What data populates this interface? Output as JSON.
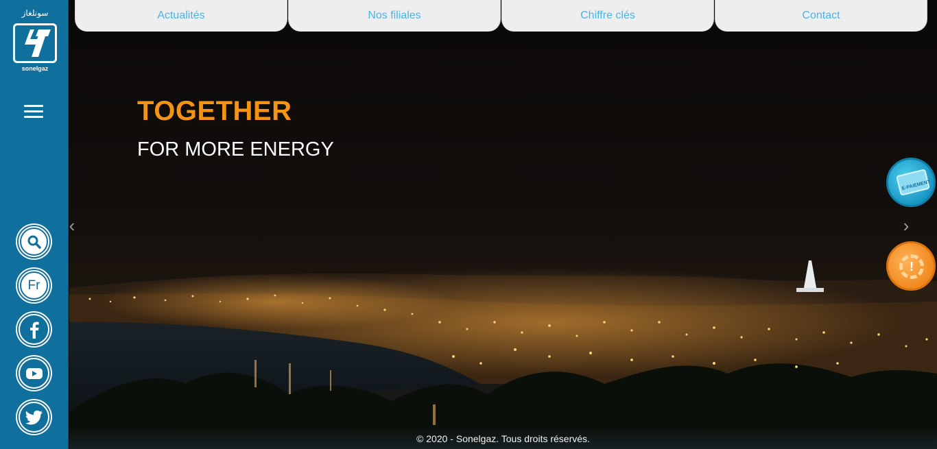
{
  "brand": {
    "logo_arabic": "سونلغاز",
    "logo_name": "sonelgaz"
  },
  "nav": {
    "items": [
      "Actualités",
      "Nos filiales",
      "Chiffre clés",
      "Contact"
    ]
  },
  "hero": {
    "slogan_main": "TOGETHER",
    "slogan_sub": "FOR MORE ENERGY",
    "slogan_main_color": "#f39415"
  },
  "sidebar": {
    "language_label": "Fr",
    "menu_icon": "hamburger-icon",
    "social_icons": [
      "search-icon",
      "language-button",
      "facebook-icon",
      "youtube-icon",
      "twitter-icon"
    ]
  },
  "floating": {
    "epay_label": "E-PAIEMENT",
    "alert_label": "!"
  },
  "footer": {
    "copyright": "© 2020 - Sonelgaz. Tous droits réservés."
  },
  "colors": {
    "sidebar": "#0f6f9d",
    "nav_text": "#4ab3e6",
    "nav_bg": "#eeeeee"
  }
}
